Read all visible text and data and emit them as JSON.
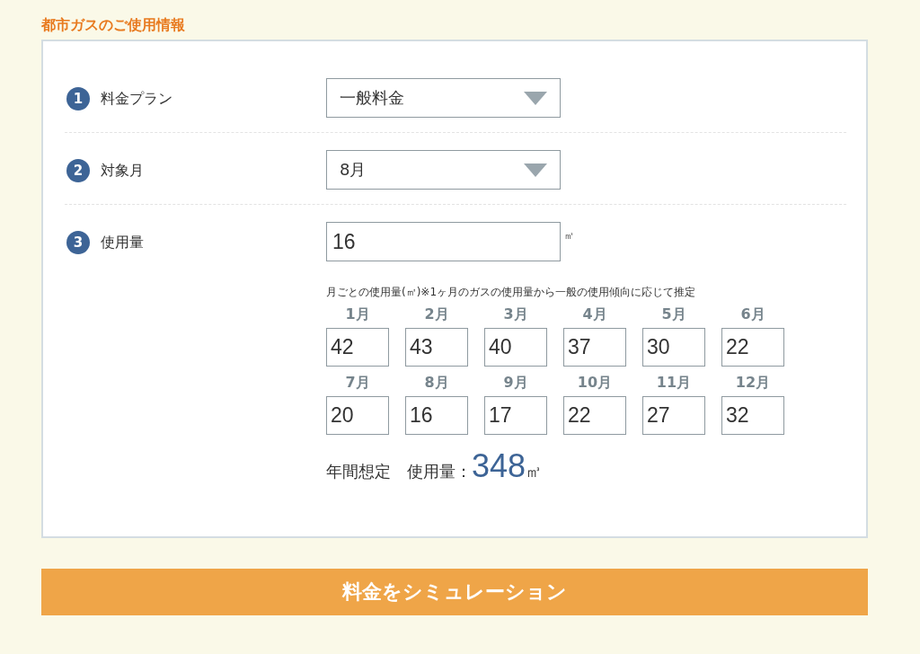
{
  "section_title": "都市ガスのご使用情報",
  "rows": [
    {
      "kind": "select",
      "number": "1",
      "label": "料金プラン",
      "value": "一般料金"
    },
    {
      "kind": "select",
      "number": "2",
      "label": "対象月",
      "value": "8月"
    },
    {
      "kind": "input",
      "number": "3",
      "label": "使用量",
      "value": "16",
      "unit": "㎥"
    }
  ],
  "monthly": {
    "note": "月ごとの使用量(㎥)※1ヶ月のガスの使用量から一般の使用傾向に応じて推定",
    "months": [
      {
        "label": "1月",
        "value": "42"
      },
      {
        "label": "2月",
        "value": "43"
      },
      {
        "label": "3月",
        "value": "40"
      },
      {
        "label": "4月",
        "value": "37"
      },
      {
        "label": "5月",
        "value": "30"
      },
      {
        "label": "6月",
        "value": "22"
      },
      {
        "label": "7月",
        "value": "20"
      },
      {
        "label": "8月",
        "value": "16"
      },
      {
        "label": "9月",
        "value": "17"
      },
      {
        "label": "10月",
        "value": "22"
      },
      {
        "label": "11月",
        "value": "27"
      },
      {
        "label": "12月",
        "value": "32"
      }
    ]
  },
  "annual": {
    "label": "年間想定　使用量：",
    "value": "348",
    "unit": "㎥"
  },
  "submit": "料金をシミュレーション"
}
